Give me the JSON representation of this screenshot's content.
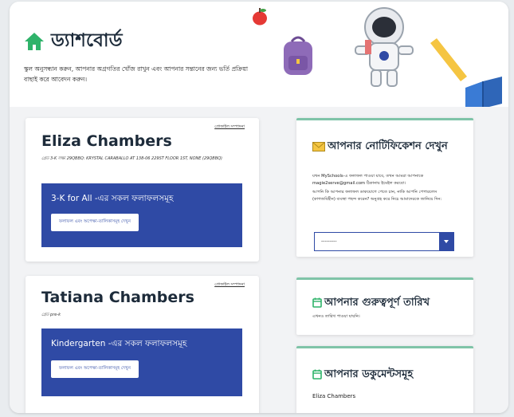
{
  "header": {
    "title": "ড্যাশবোর্ড",
    "intro": "স্কুল অনুসন্ধান করুন, আপনার অগ্রগতির খোঁজ রাখুন এবং আপনার সন্তানের জন্য ভর্তি প্রক্রিয়া বাছাই করে আবেদন করুন।"
  },
  "students": [
    {
      "name": "Eliza Chambers",
      "edit_label": "প্রোফাইল সম্পাদনা",
      "meta": "গ্রেড 3-K লক্ষ্য 29QBBQ: KRYSTAL CARABALLO AT 138-06 229ST FLOOR 1ST, NONE (29QBBQ)",
      "panel_title": "3-K for All -এর সকল ফলাফলসমূহ",
      "button_label": "ফলাফল এবং অপেক্ষা-তালিকাসমূহ দেখুন"
    },
    {
      "name": "Tatiana Chambers",
      "edit_label": "প্রোফাইল সম্পাদনা",
      "meta": "গ্রেড pre-k",
      "panel_title": "Kindergarten -এর সকল ফলাফলসমূহ",
      "button_label": "ফলাফল এবং অপেক্ষা-তালিকাসমূহ দেখুন"
    }
  ],
  "notifications": {
    "title": "আপনার নোটিফিকেশন দেখুন",
    "text1": "যখন MySchools-এ ফলাফল পাওয়া যাবে, তখন আমরা আপনাকে magie2serve@gmail.com ঠিকানায় ইমেইল করবো।",
    "text2": "আপনি কি আপনার ফলাফল ডাকযোগে পেতে চান, নাকি আপনি পেপারলেস (কাগজবিহীন) ব্যবস্থা পছন্দ করেন? অনুগ্রহ করে নিচে আমাদেরকে জানিয়ে দিন:",
    "select_value": "---------"
  },
  "important_dates": {
    "title": "আপনার গুরুত্বপূর্ণ তারিখ",
    "text": "এখনও তারিখ পাওয়া যায়নি।"
  },
  "documents": {
    "title": "আপনার ডকুমেন্টসমূহ",
    "student": "Eliza Chambers"
  },
  "colors": {
    "accent_green": "#2fb36a",
    "panel_blue": "#2f4aa5",
    "card_top_border": "#7fc4a8"
  },
  "icons": [
    "home-icon",
    "envelope-icon",
    "calendar-icon",
    "chevron-down-icon",
    "apple-icon",
    "backpack-icon",
    "astronaut-icon",
    "ruler-icon",
    "book-icon"
  ]
}
